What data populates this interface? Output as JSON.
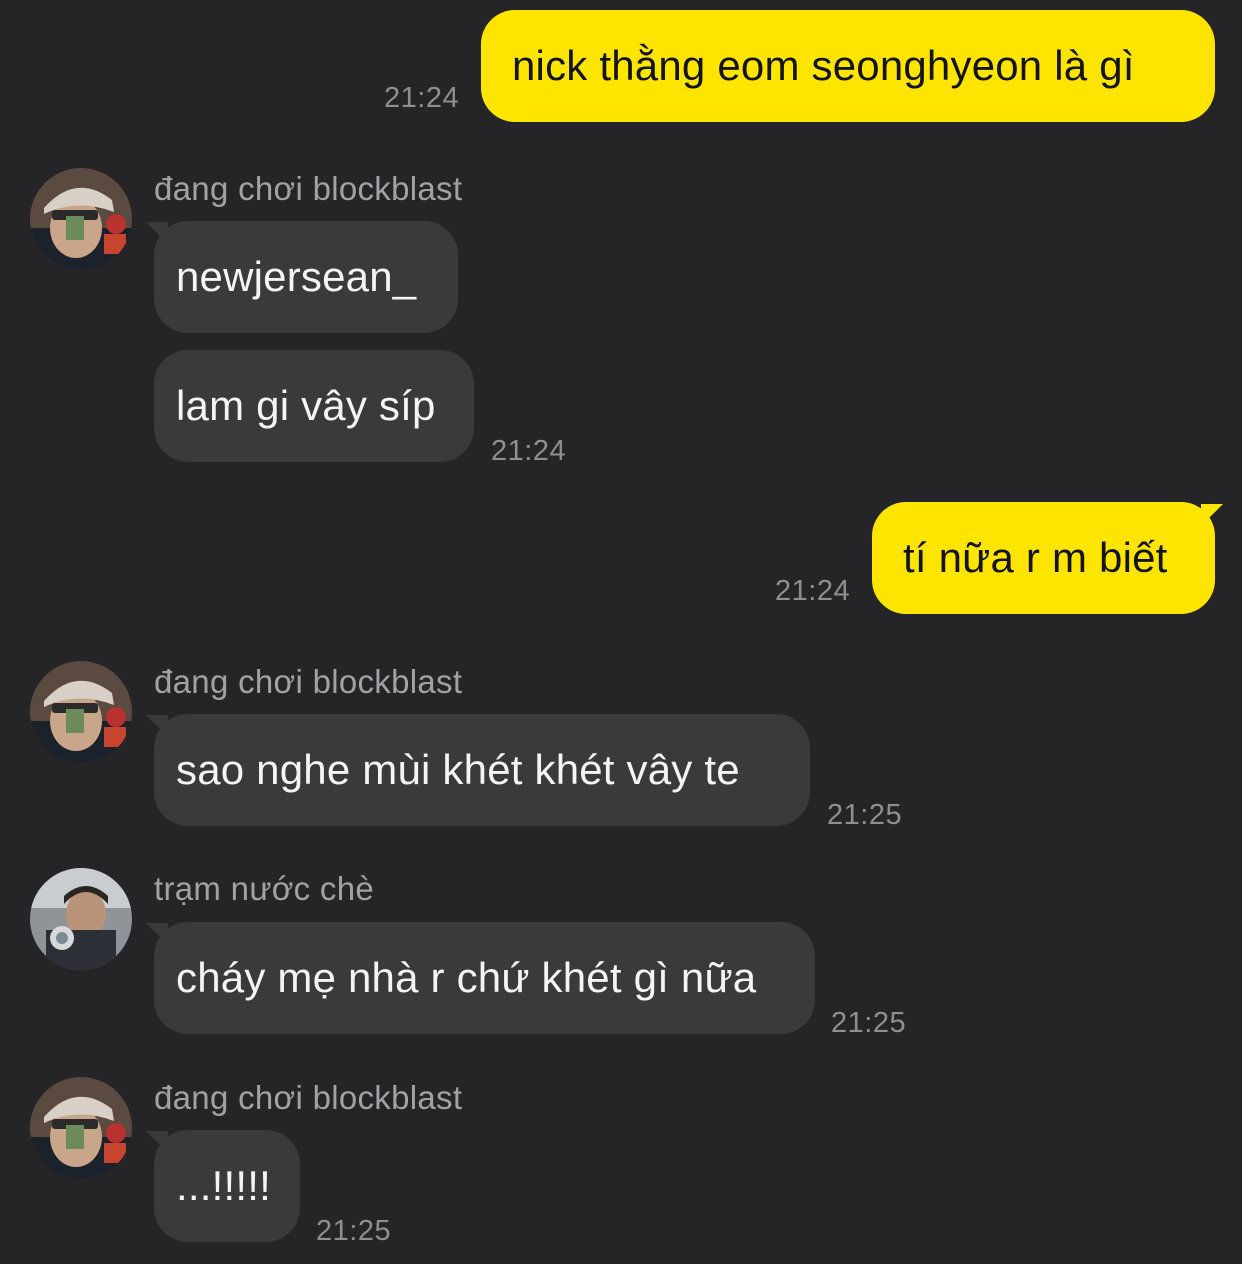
{
  "messages": [
    {
      "direction": "outgoing",
      "text": "nick thằng eom seonghyeon là gì",
      "time": "21:24"
    },
    {
      "direction": "incoming",
      "sender": "đang chơi blockblast",
      "avatar": "avatar-blockblast",
      "text": "newjersean_"
    },
    {
      "direction": "incoming",
      "text": "lam gi vây síp",
      "time": "21:24"
    },
    {
      "direction": "outgoing",
      "text": "tí nữa r m biết",
      "time": "21:24"
    },
    {
      "direction": "incoming",
      "sender": "đang chơi blockblast",
      "avatar": "avatar-blockblast",
      "text": "sao nghe mùi khét khét vây te",
      "time": "21:25"
    },
    {
      "direction": "incoming",
      "sender": "trạm nước chè",
      "avatar": "avatar-tram-nuoc-che",
      "text": "cháy mẹ nhà r chứ khét gì nữa",
      "time": "21:25"
    },
    {
      "direction": "incoming",
      "sender": "đang chơi blockblast",
      "avatar": "avatar-blockblast",
      "text": "...!!!!!",
      "time": "21:25"
    }
  ],
  "colors": {
    "background": "#252527",
    "outgoing_bubble": "#fee500",
    "incoming_bubble": "#3a3a3c",
    "timestamp": "#8e8e93",
    "sender_name": "#a2a2a6"
  }
}
